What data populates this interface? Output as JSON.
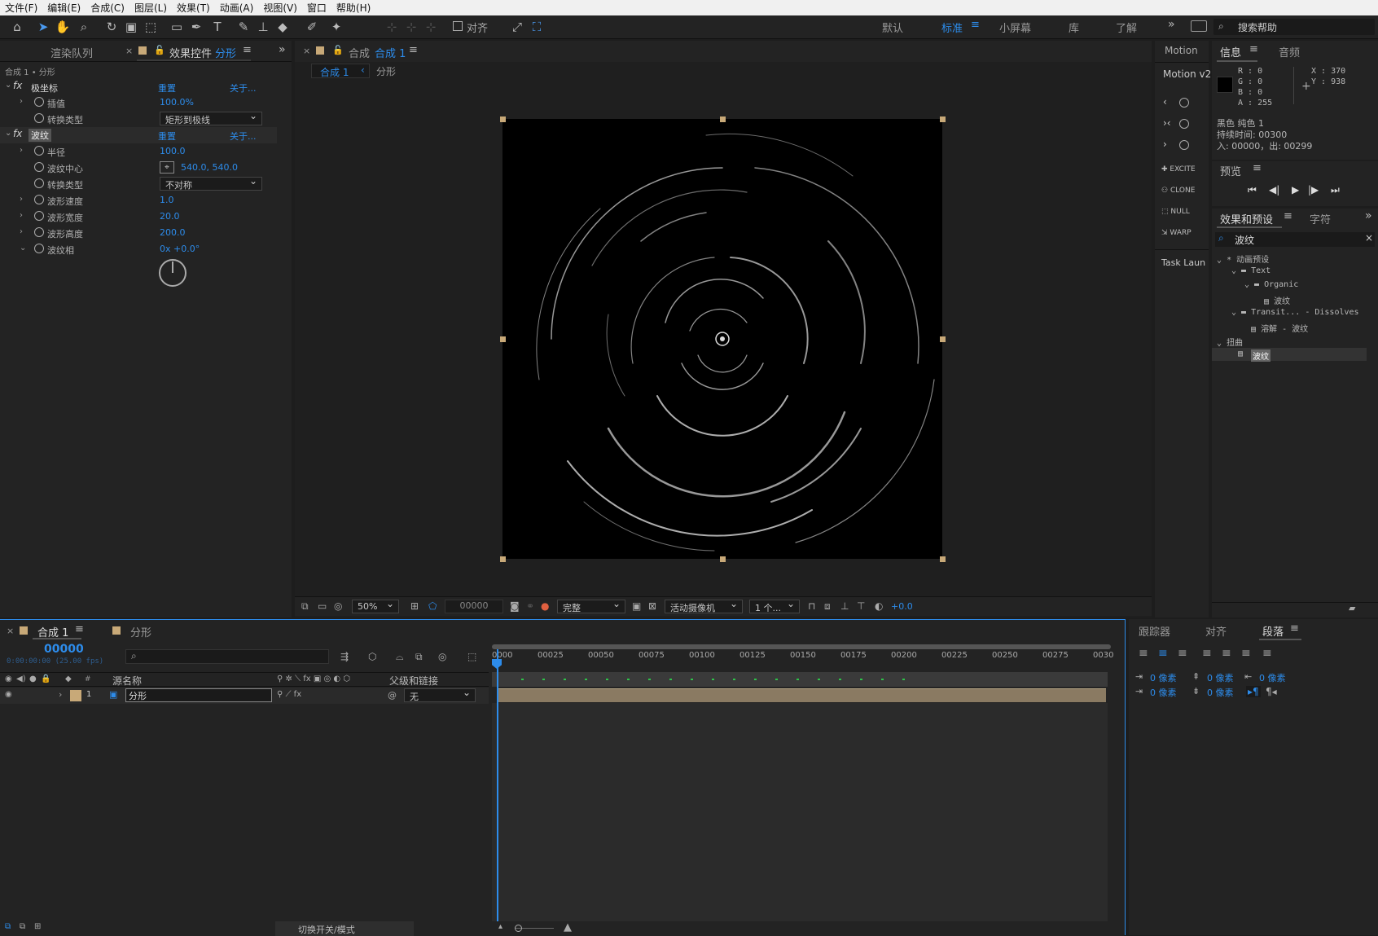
{
  "menu": [
    "文件(F)",
    "编辑(E)",
    "合成(C)",
    "图层(L)",
    "效果(T)",
    "动画(A)",
    "视图(V)",
    "窗口",
    "帮助(H)"
  ],
  "toolbar": {
    "snap_label": "对齐",
    "workspaces": [
      "默认",
      "标准",
      "小屏幕",
      "库",
      "了解"
    ],
    "active_workspace": "标准",
    "search_placeholder": "搜索帮助"
  },
  "left_panel": {
    "tabs": [
      "渲染队列",
      "效果控件"
    ],
    "active_tab_layer": "分形",
    "breadcrumb": "合成 1 • 分形",
    "effects": [
      {
        "name": "极坐标",
        "reset": "重置",
        "about": "关于...",
        "props": [
          {
            "label": "插值",
            "value": "100.0%"
          },
          {
            "label": "转换类型",
            "value": "矩形到极线"
          }
        ]
      },
      {
        "name": "波纹",
        "reset": "重置",
        "about": "关于...",
        "props": [
          {
            "label": "半径",
            "value": "100.0"
          },
          {
            "label": "波纹中心",
            "value": "540.0, 540.0"
          },
          {
            "label": "转换类型",
            "value": "不对称"
          },
          {
            "label": "波形速度",
            "value": "1.0"
          },
          {
            "label": "波形宽度",
            "value": "20.0"
          },
          {
            "label": "波形高度",
            "value": "200.0"
          },
          {
            "label": "波纹相",
            "value": "0x +0.0°"
          }
        ]
      }
    ]
  },
  "viewer": {
    "tab_prefix": "合成",
    "tab_comp": "合成 1",
    "crumbs": [
      "合成 1",
      "分形"
    ],
    "zoom": "50%",
    "timecode": "00000",
    "resolution": "完整",
    "camera": "活动摄像机",
    "views": "1 个...",
    "exposure": "+0.0"
  },
  "scripts_panel": {
    "tab": "Motion",
    "title": "Motion v2",
    "buttons": [
      "EXCITE",
      "CLONE",
      "NULL",
      "WARP"
    ],
    "task": "Task Laun"
  },
  "info_panel": {
    "tabs": [
      "信息",
      "音频"
    ],
    "r": "R : 0",
    "g": "G : 0",
    "b": "B : 0",
    "a": "A : 255",
    "x": "X : 370",
    "y": "Y : 938",
    "layer": "黑色 纯色 1",
    "duration": "持续时间: 00300",
    "inout": "入: 00000，出: 00299"
  },
  "preview_panel": {
    "title": "预览"
  },
  "effects_presets": {
    "tabs": [
      "效果和预设",
      "字符"
    ],
    "search": "波纹",
    "tree": [
      "* 动画预设",
      "Text",
      "Organic",
      "波纹",
      "Transit... - Dissolves",
      "溶解 - 波纹",
      "扭曲",
      "波纹"
    ]
  },
  "timeline": {
    "tab_active": "合成 1",
    "tab_other": "分形",
    "timecode": "00000",
    "timecode_sub": "0:00:00:00 (25.00 fps)",
    "col_name": "源名称",
    "col_parent": "父级和链接",
    "layer_num": "1",
    "layer_name": "分形",
    "parent_value": "无",
    "ruler": [
      "0000",
      "00025",
      "00050",
      "00075",
      "00100",
      "00125",
      "00150",
      "00175",
      "00200",
      "00225",
      "00250",
      "00275",
      "0030"
    ],
    "footer": "切换开关/模式"
  },
  "paragraph_panel": {
    "tabs": [
      "跟踪器",
      "对齐",
      "段落"
    ],
    "fields": [
      "0 像素",
      "0 像素",
      "0 像素",
      "0 像素",
      "0 像素"
    ]
  }
}
